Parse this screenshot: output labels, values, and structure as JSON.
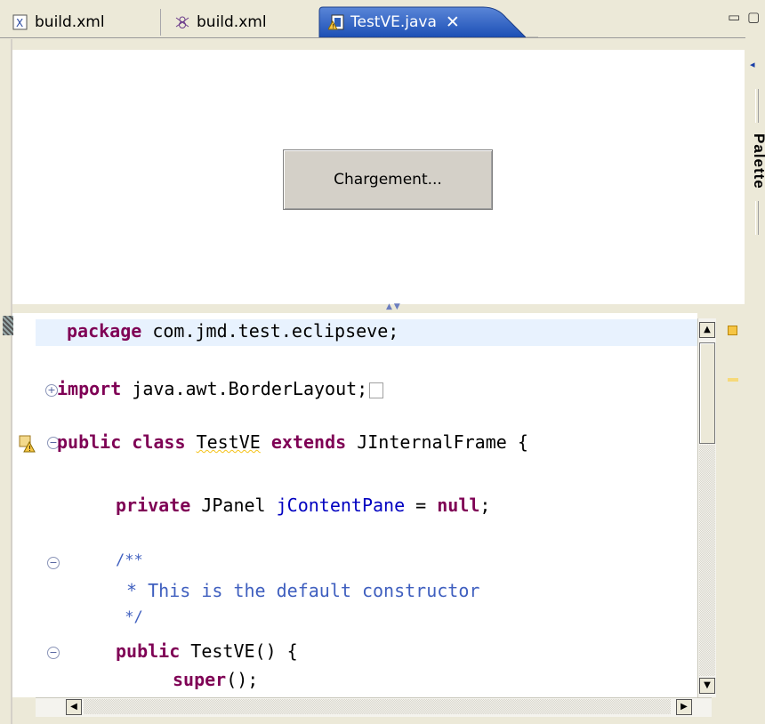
{
  "tabs": [
    {
      "label": "build.xml",
      "icon": "xml-file-icon"
    },
    {
      "label": "build.xml",
      "icon": "ant-build-icon"
    },
    {
      "label": "TestVE.java",
      "icon": "java-file-warning-icon",
      "close": "✕"
    }
  ],
  "window_controls": {
    "minimize": "▭",
    "maximize": "▢"
  },
  "canvas": {
    "button_label": "Chargement..."
  },
  "palette": {
    "label": "Palette",
    "arrow": "◂"
  },
  "code": {
    "l1_kw": "package",
    "l1_rest": " com.jmd.test.eclipseve;",
    "l2_kw": "import",
    "l2_rest": " java.awt.BorderLayout;",
    "l3_kw1": "public",
    "l3_kw2": "class",
    "l3_name": "TestVE",
    "l3_kw3": "extends",
    "l3_rest": " JInternalFrame {",
    "l4_kw": "private",
    "l4_type": " JPanel ",
    "l4_field": "jContentPane",
    "l4_eq": " = ",
    "l4_kw2": "null",
    "l4_end": ";",
    "l5": "/**",
    "l6": " * This is the default constructor",
    "l7": " */",
    "l8_kw": "public",
    "l8_rest": " TestVE() {",
    "l9_kw": "super",
    "l9_rest": "();"
  },
  "colors": {
    "keyword": "#7f0055",
    "field": "#0000c0",
    "comment": "#3f5fbf",
    "active_tab": "#1c4fb5"
  }
}
